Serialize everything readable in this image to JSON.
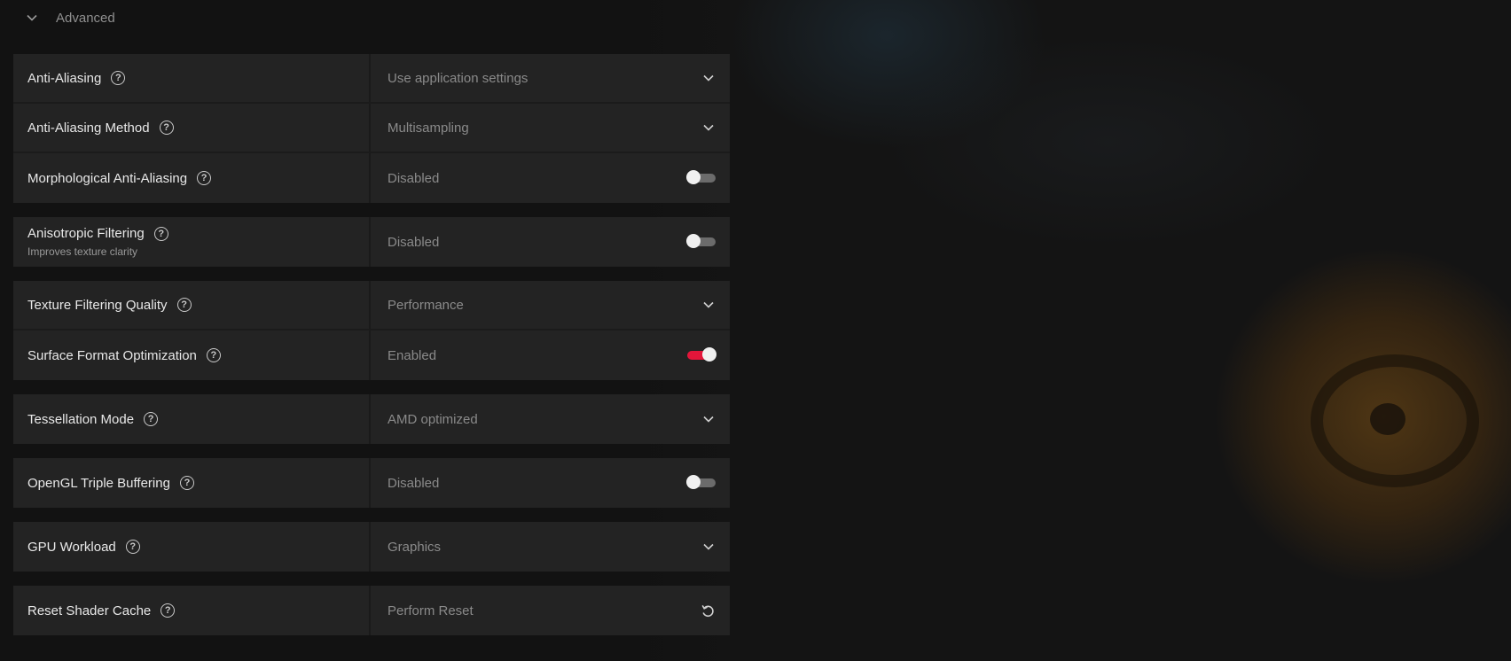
{
  "section": {
    "title": "Advanced",
    "icon": "chevron-down-icon"
  },
  "colors": {
    "accent": "#e3163a",
    "row_bg": "#232323",
    "page_bg": "#121212"
  },
  "groups": [
    {
      "rows": [
        {
          "label": "Anti-Aliasing",
          "value": "Use application settings",
          "control": "dropdown"
        },
        {
          "label": "Anti-Aliasing Method",
          "value": "Multisampling",
          "control": "dropdown"
        },
        {
          "label": "Morphological Anti-Aliasing",
          "value": "Disabled",
          "control": "toggle",
          "on": false
        }
      ]
    },
    {
      "rows": [
        {
          "label": "Anisotropic Filtering",
          "sublabel": "Improves texture clarity",
          "value": "Disabled",
          "control": "toggle",
          "on": false
        }
      ]
    },
    {
      "rows": [
        {
          "label": "Texture Filtering Quality",
          "value": "Performance",
          "control": "dropdown"
        },
        {
          "label": "Surface Format Optimization",
          "value": "Enabled",
          "control": "toggle",
          "on": true
        }
      ]
    },
    {
      "rows": [
        {
          "label": "Tessellation Mode",
          "value": "AMD optimized",
          "control": "dropdown"
        }
      ]
    },
    {
      "rows": [
        {
          "label": "OpenGL Triple Buffering",
          "value": "Disabled",
          "control": "toggle",
          "on": false
        }
      ]
    },
    {
      "rows": [
        {
          "label": "GPU Workload",
          "value": "Graphics",
          "control": "dropdown"
        }
      ]
    },
    {
      "rows": [
        {
          "label": "Reset Shader Cache",
          "value": "Perform Reset",
          "control": "reset"
        }
      ]
    }
  ],
  "help_glyph": "?"
}
